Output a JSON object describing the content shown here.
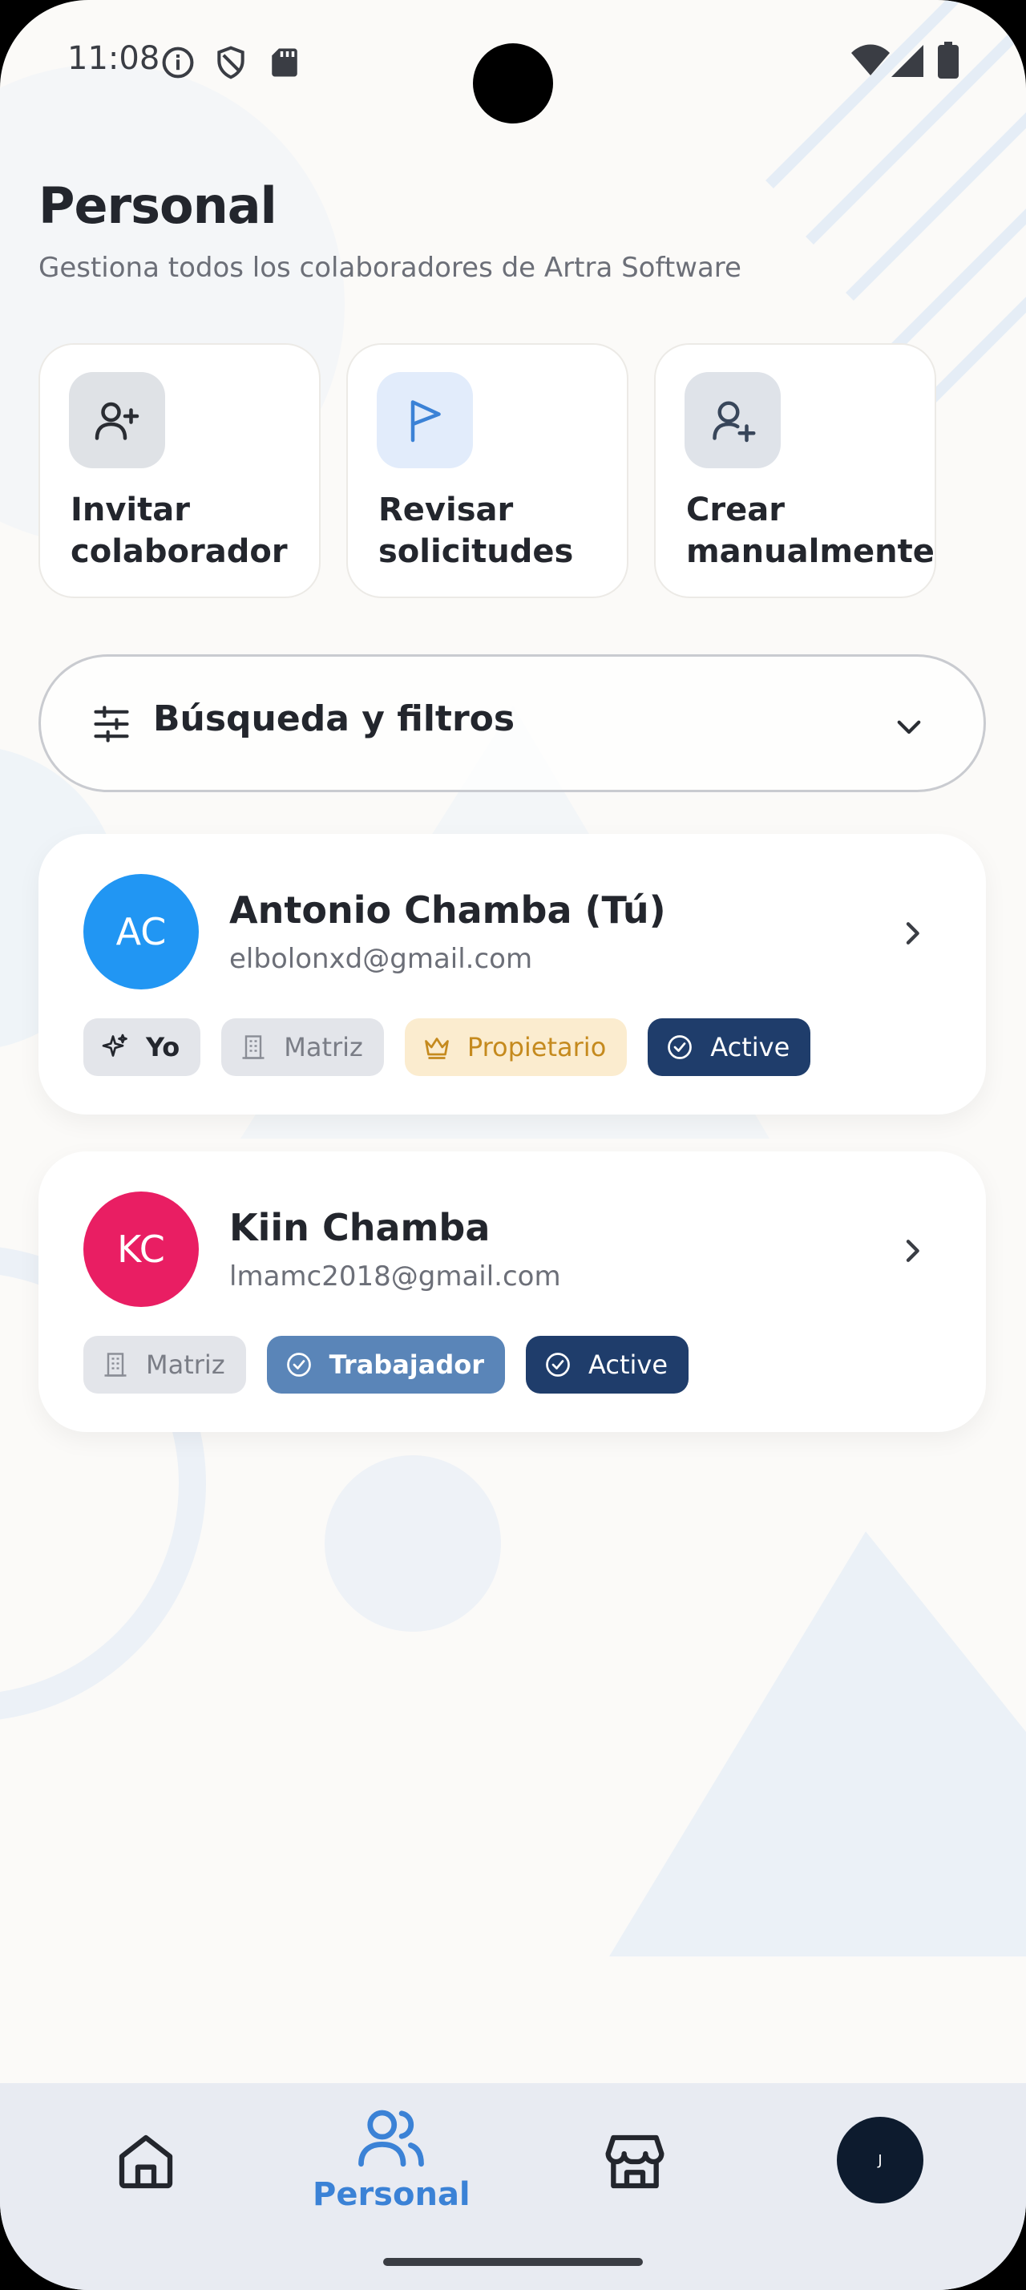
{
  "status_bar": {
    "time": "11:08"
  },
  "header": {
    "title": "Personal",
    "subtitle": "Gestiona todos los colaboradores de Artra Software"
  },
  "quick_actions": [
    {
      "label": "Invitar colaborador",
      "icon": "user-plus-icon"
    },
    {
      "label": "Revisar solicitudes",
      "icon": "flag-icon"
    },
    {
      "label": "Crear manualmente",
      "icon": "user-add-icon"
    }
  ],
  "filter": {
    "label": "Búsqueda y filtros"
  },
  "members": [
    {
      "initials": "AC",
      "name": "Antonio Chamba (Tú)",
      "email": "elbolonxd@gmail.com",
      "avatar_color": "#2196f3",
      "badges": {
        "yo": "Yo",
        "matriz": "Matriz",
        "rol": "Propietario",
        "estado": "Active"
      }
    },
    {
      "initials": "KC",
      "name": "Kiin Chamba",
      "email": "lmamc2018@gmail.com",
      "avatar_color": "#e91e63",
      "badges": {
        "matriz": "Matriz",
        "rol": "Trabajador",
        "estado": "Active"
      }
    }
  ],
  "nav": {
    "active_label": "Personal",
    "profile_initial": "J"
  },
  "colors": {
    "accent": "#3b82d6",
    "active_badge": "#1f3d6b",
    "owner_badge_bg": "#fbeccf",
    "worker_badge_bg": "#5a85b8"
  }
}
